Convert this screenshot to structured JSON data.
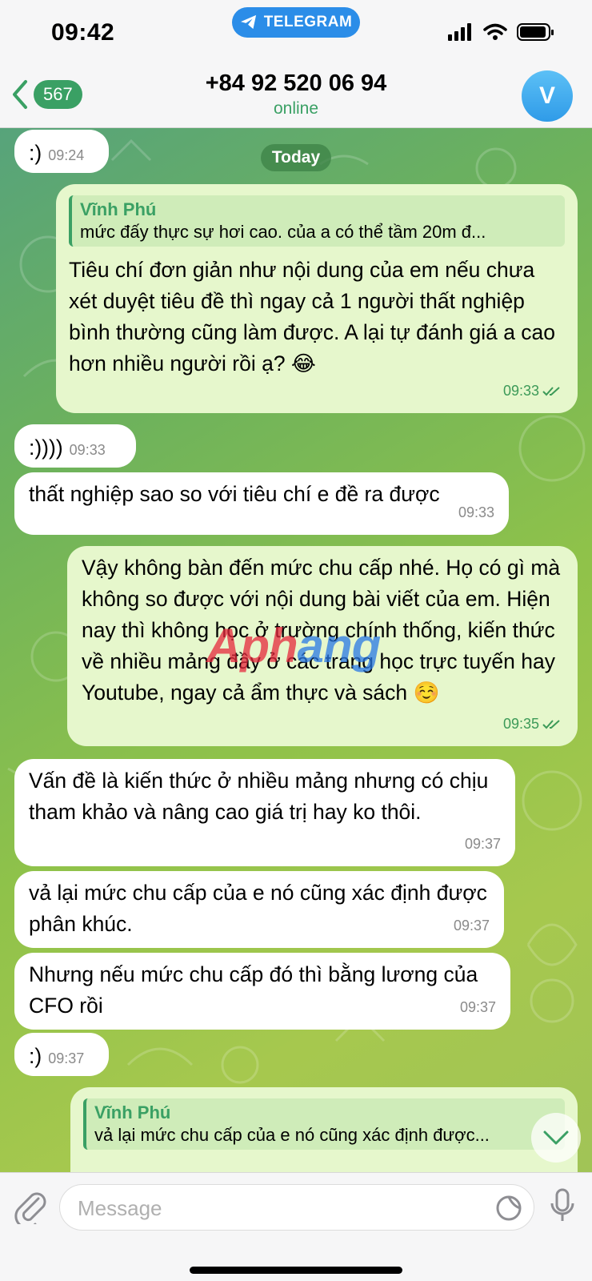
{
  "status_bar": {
    "time": "09:42",
    "app_pill": "TELEGRAM"
  },
  "header": {
    "back_count": "567",
    "contact": "+84 92 520 06 94",
    "status": "online",
    "avatar_letter": "V"
  },
  "date_label": "Today",
  "messages": [
    {
      "side": "in",
      "text": ":)",
      "time": "09:24"
    },
    {
      "side": "out",
      "reply_name": "Vĩnh Phú",
      "reply_text": "mức đấy thực sự hơi cao. của a có thể tầm 20m đ...",
      "text": "Tiêu chí đơn giản như nội dung của em nếu chưa xét duyệt tiêu đề thì ngay cả 1 người thất nghiệp bình thường cũng làm được. A lại tự đánh giá a cao hơn nhiều người rồi ạ? 😂",
      "time": "09:33"
    },
    {
      "side": "in",
      "text": ":))))",
      "time": "09:33"
    },
    {
      "side": "in",
      "text": "thất nghiệp sao so với tiêu chí e đề ra được",
      "time": "09:33"
    },
    {
      "side": "out",
      "text": "Vậy không bàn đến mức chu cấp nhé. Họ có gì mà không so được với nội dung bài viết của em. Hiện nay thì không học ở trường chính thống, kiến thức về nhiều mảng đầy ở các trang học trực tuyến hay Youtube, ngay cả ẩm thực và sách ☺️",
      "time": "09:35"
    },
    {
      "side": "in",
      "text": "Vấn đề là kiến thức ở nhiều mảng nhưng có chịu tham khảo và nâng cao giá trị hay ko thôi.",
      "time": "09:37"
    },
    {
      "side": "in",
      "text": "vả lại mức chu cấp của e nó cũng xác định được phân khúc.",
      "time": "09:37"
    },
    {
      "side": "in",
      "text": "Nhưng nếu mức chu cấp đó thì bằng lương của CFO rồi",
      "time": "09:37"
    },
    {
      "side": "in",
      "text": ":)",
      "time": "09:37"
    },
    {
      "side": "out",
      "reply_name": "Vĩnh Phú",
      "reply_text": "vả lại mức chu cấp của e nó cũng xác định được..."
    }
  ],
  "watermark": {
    "part1": "Aph",
    "part2": "ang"
  },
  "input": {
    "placeholder": "Message"
  },
  "icons": {
    "back": "chevron-left-icon",
    "attach": "paperclip-icon",
    "sticker": "sticker-icon",
    "mic": "microphone-icon",
    "scroll": "chevron-down-icon",
    "telegram": "telegram-plane-icon"
  },
  "colors": {
    "accent": "#3aa064",
    "outgoing_bubble": "#e6f7cc",
    "incoming_bubble": "#ffffff",
    "pill": "#2b8de8"
  }
}
